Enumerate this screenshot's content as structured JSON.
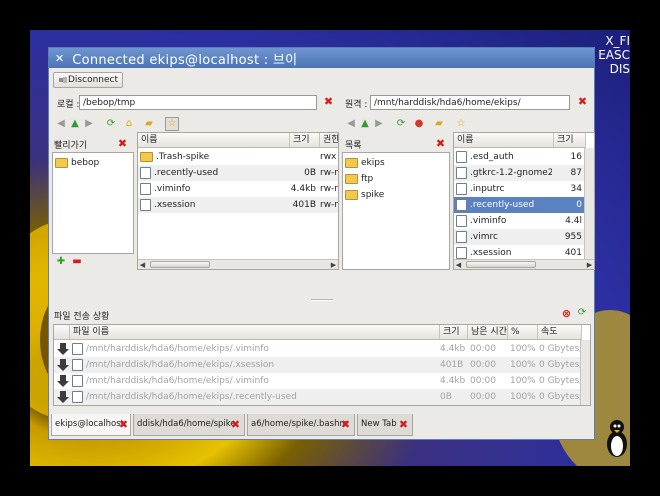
{
  "desktop": {
    "text_lines": [
      "X_FI",
      "EASC",
      "DIS"
    ]
  },
  "window": {
    "title": "Connected ekips@localhost : 브이"
  },
  "toolbar": {
    "disconnect_label": "Disconnect"
  },
  "local": {
    "label": "로컬 :",
    "path": "/bebop/tmp",
    "bookmarks_title": "빨리가기",
    "bookmarks": [
      {
        "name": "bebop",
        "icon": "folder-icon"
      }
    ],
    "columns": [
      "이름",
      "크기",
      "권한"
    ],
    "files": [
      {
        "name": ".Trash-spike",
        "size": "",
        "perm": "rwx",
        "type": "folder"
      },
      {
        "name": ".recently-used",
        "size": "0B",
        "perm": "rw-r",
        "type": "file"
      },
      {
        "name": ".viminfo",
        "size": "4.4kb",
        "perm": "rw-r",
        "type": "file"
      },
      {
        "name": ".xsession",
        "size": "401B",
        "perm": "rw-r",
        "type": "file"
      }
    ]
  },
  "remote": {
    "label": "원격 :",
    "path": "/mnt/harddisk/hda6/home/ekips/",
    "list_title": "목록",
    "dirs": [
      {
        "name": "ekips"
      },
      {
        "name": "ftp"
      },
      {
        "name": "spike"
      }
    ],
    "columns": [
      "이름",
      "크기"
    ],
    "files": [
      {
        "name": ".esd_auth",
        "size": "16"
      },
      {
        "name": ".gtkrc-1.2-gnome2",
        "size": "87"
      },
      {
        "name": ".inputrc",
        "size": "34"
      },
      {
        "name": ".recently-used",
        "size": "0",
        "selected": true
      },
      {
        "name": ".viminfo",
        "size": "4.4l"
      },
      {
        "name": ".vimrc",
        "size": "955"
      },
      {
        "name": ".xsession",
        "size": "401"
      }
    ]
  },
  "transfers": {
    "title": "파일 전송 상황",
    "columns": [
      "파일 이름",
      "크기",
      "남은 시간",
      "%",
      "속도"
    ],
    "rows": [
      {
        "name": "/mnt/harddisk/hda6/home/ekips/.viminfo",
        "size": "4.4kb",
        "remaining": "00:00",
        "percent": "100%",
        "speed": "0 Gbytes/s"
      },
      {
        "name": "/mnt/harddisk/hda6/home/ekips/.xsession",
        "size": "401B",
        "remaining": "00:00",
        "percent": "100%",
        "speed": "0 Gbytes/s"
      },
      {
        "name": "/mnt/harddisk/hda6/home/ekips/.viminfo",
        "size": "4.4kb",
        "remaining": "00:00",
        "percent": "100%",
        "speed": "0 Gbytes/s"
      },
      {
        "name": "/mnt/harddisk/hda6/home/ekips/.recently-used",
        "size": "0B",
        "remaining": "00:00",
        "percent": "100%",
        "speed": "0 Gbytes/s"
      }
    ]
  },
  "tabs": [
    {
      "label": "ekips@localhost",
      "active": true
    },
    {
      "label": "ddisk/hda6/home/spike",
      "active": false
    },
    {
      "label": "a6/home/spike/.bashrc",
      "active": false
    },
    {
      "label": "New Tab",
      "active": false
    }
  ],
  "colors": {
    "selection": "#5b82c0",
    "titlebar": "#4b74b5",
    "close_red": "#d61b1b"
  }
}
